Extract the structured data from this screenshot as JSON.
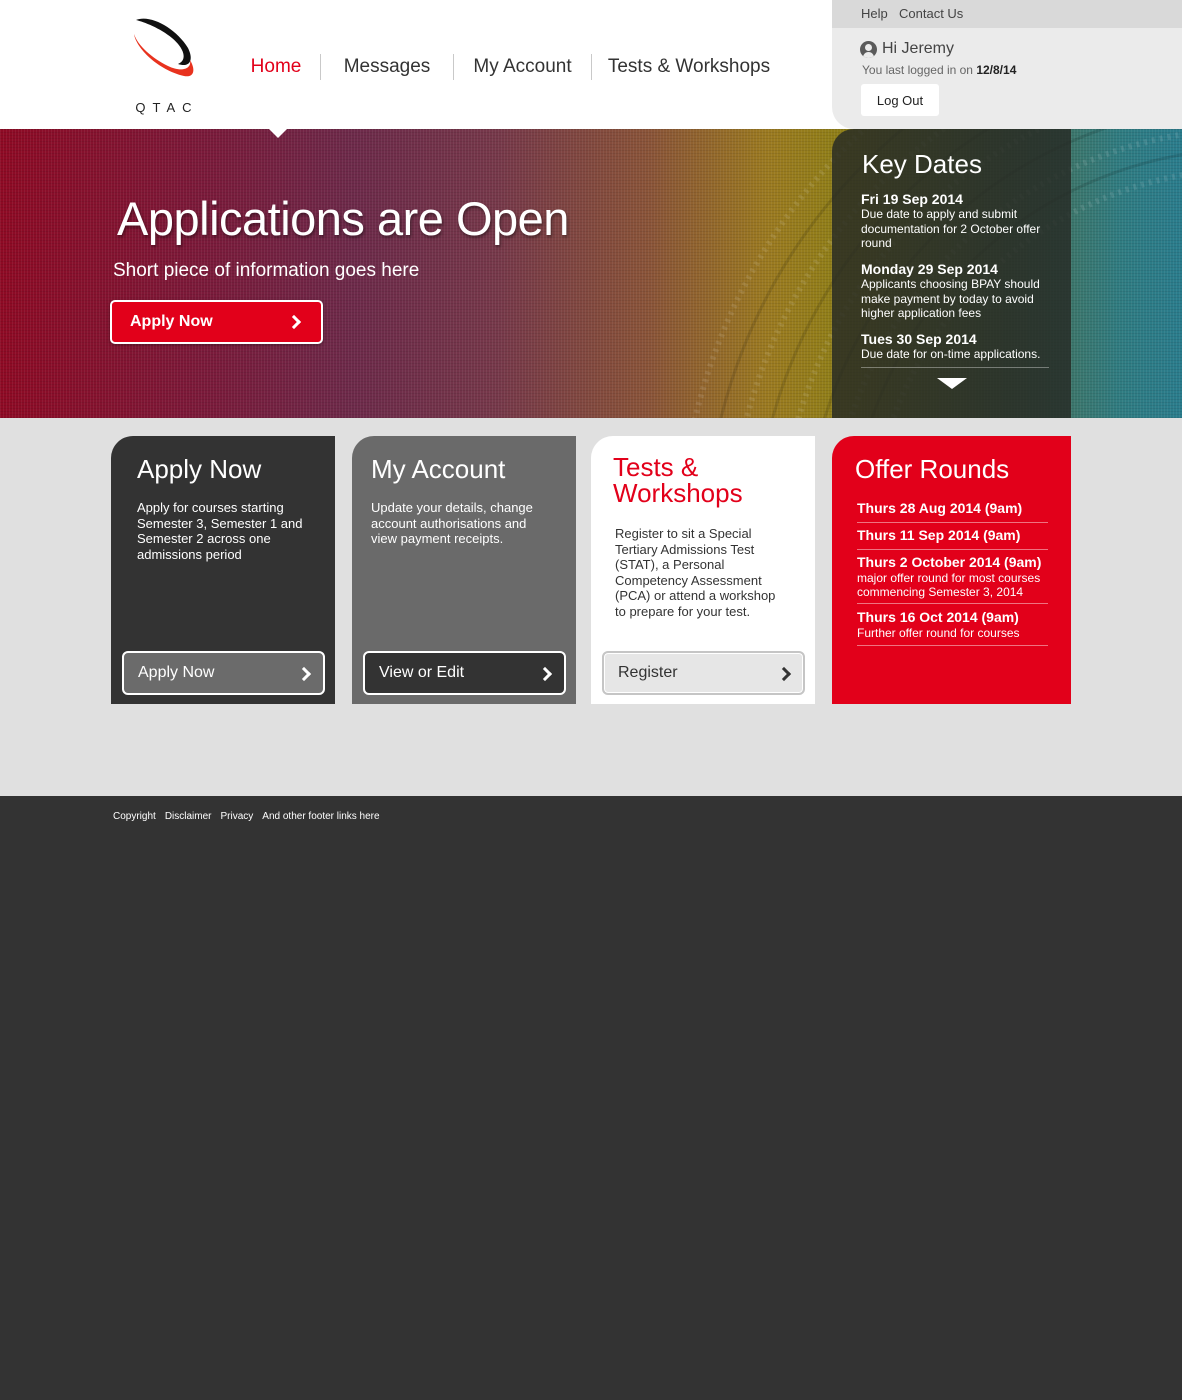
{
  "brand": {
    "logo_text": "QTAC",
    "accent_color": "#e2001a"
  },
  "nav": {
    "items": [
      {
        "label": "Home",
        "active": true
      },
      {
        "label": "Messages",
        "active": false
      },
      {
        "label": "My Account",
        "active": false
      },
      {
        "label": "Tests & Workshops",
        "active": false
      }
    ]
  },
  "user_panel": {
    "help_label": "Help",
    "contact_label": "Contact Us",
    "greeting": "Hi Jeremy",
    "last_login_prefix": "You last logged in on",
    "last_login_date": "12/8/14",
    "logout_label": "Log Out"
  },
  "hero": {
    "title": "Applications are Open",
    "subtitle": "Short piece of information goes here",
    "button_label": "Apply Now"
  },
  "key_dates": {
    "title": "Key Dates",
    "items": [
      {
        "date": "Fri 19 Sep 2014",
        "desc": "Due date to apply and submit documentation for 2 October offer round"
      },
      {
        "date": "Monday 29 Sep 2014",
        "desc": "Applicants choosing BPAY should make payment by today to avoid higher application fees"
      },
      {
        "date": "Tues 30 Sep 2014",
        "desc": "Due date for on-time applications."
      }
    ]
  },
  "cards": {
    "apply": {
      "title": "Apply Now",
      "desc": "Apply for courses starting Semester 3, Semester 1 and Semester 2 across one admissions period",
      "button_label": "Apply Now"
    },
    "account": {
      "title": "My Account",
      "desc": "Update your details, change account authorisations and view payment receipts.",
      "button_label": "View or Edit"
    },
    "tests": {
      "title": "Tests & Workshops",
      "desc": "Register to sit a Special Tertiary Admissions Test (STAT), a Personal Competency Assessment (PCA) or attend a workshop to prepare for your test.",
      "button_label": "Register"
    },
    "offers": {
      "title": "Offer Rounds",
      "items": [
        {
          "date": "Thurs 28 Aug 2014 (9am)",
          "desc": ""
        },
        {
          "date": "Thurs 11 Sep 2014 (9am)",
          "desc": ""
        },
        {
          "date": "Thurs 2 October 2014 (9am)",
          "desc": "major offer round for most courses commencing Semester 3, 2014"
        },
        {
          "date": "Thurs 16 Oct 2014 (9am)",
          "desc": "Further offer round for courses"
        }
      ]
    }
  },
  "footer": {
    "links": [
      "Copyright",
      "Disclaimer",
      "Privacy",
      "And other footer links here"
    ]
  }
}
